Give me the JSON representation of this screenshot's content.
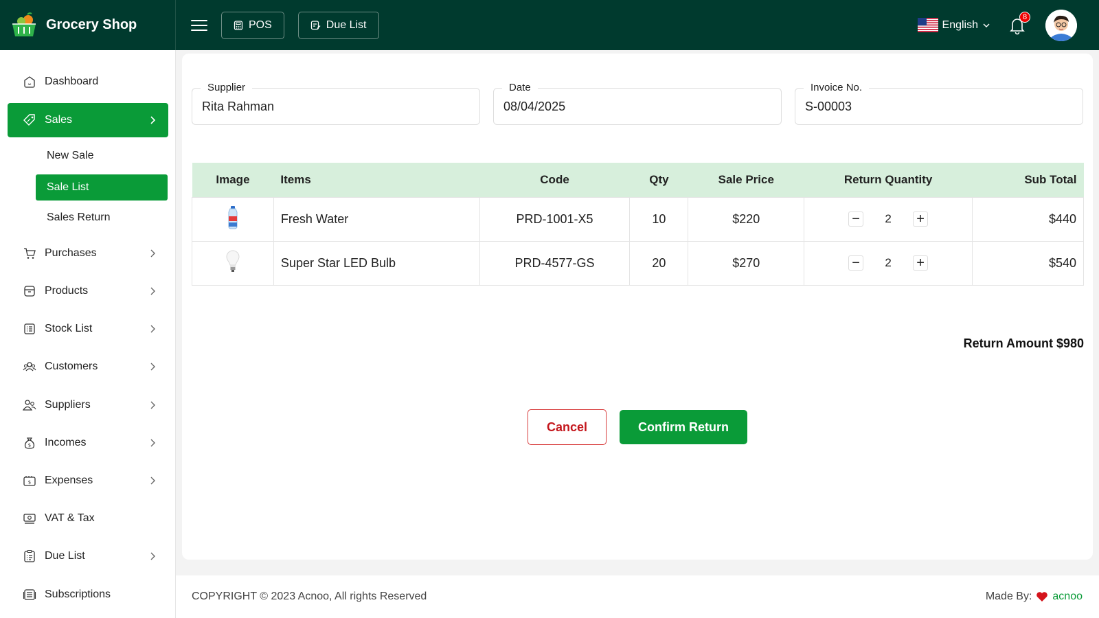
{
  "brand": {
    "name": "Grocery Shop"
  },
  "topbar": {
    "pos_label": "POS",
    "due_list_label": "Due List",
    "language": "English",
    "notification_count": "8"
  },
  "sidebar": {
    "items": [
      {
        "label": "Dashboard",
        "icon": "home-icon"
      },
      {
        "label": "Sales",
        "icon": "tag-icon",
        "active": true
      },
      {
        "label": "Purchases",
        "icon": "cart-icon"
      },
      {
        "label": "Products",
        "icon": "box-icon"
      },
      {
        "label": "Stock List",
        "icon": "list-icon"
      },
      {
        "label": "Customers",
        "icon": "users-icon"
      },
      {
        "label": "Suppliers",
        "icon": "supplier-icon"
      },
      {
        "label": "Incomes",
        "icon": "money-bag-icon"
      },
      {
        "label": "Expenses",
        "icon": "wallet-icon"
      },
      {
        "label": "VAT & Tax",
        "icon": "cash-icon"
      },
      {
        "label": "Due List",
        "icon": "clipboard-icon"
      },
      {
        "label": "Subscriptions",
        "icon": "subscription-icon"
      }
    ],
    "sales_sub": [
      "New Sale",
      "Sale List",
      "Sales Return"
    ]
  },
  "form": {
    "supplier_label": "Supplier",
    "supplier_value": "Rita Rahman",
    "date_label": "Date",
    "date_value": "08/04/2025",
    "invoice_label": "Invoice No.",
    "invoice_value": "S-00003"
  },
  "table": {
    "headers": [
      "Image",
      "Items",
      "Code",
      "Qty",
      "Sale Price",
      "Return Quantity",
      "Sub Total"
    ],
    "rows": [
      {
        "item": "Fresh Water",
        "code": "PRD-1001-X5",
        "qty": "10",
        "price": "$220",
        "return_qty": "2",
        "subtotal": "$440"
      },
      {
        "item": "Super Star LED Bulb",
        "code": "PRD-4577-GS",
        "qty": "20",
        "price": "$270",
        "return_qty": "2",
        "subtotal": "$540"
      }
    ]
  },
  "return_amount": "Return Amount $980",
  "actions": {
    "cancel": "Cancel",
    "confirm": "Confirm Return"
  },
  "footer": {
    "copyright": "COPYRIGHT © 2023 Acnoo, All rights Reserved",
    "made_by": "Made By:",
    "made_by_brand": "acnoo"
  },
  "colors": {
    "topbar": "#003a2e",
    "accent": "#0a9b38",
    "table_header": "#d7efdc",
    "danger": "#c4161c"
  }
}
